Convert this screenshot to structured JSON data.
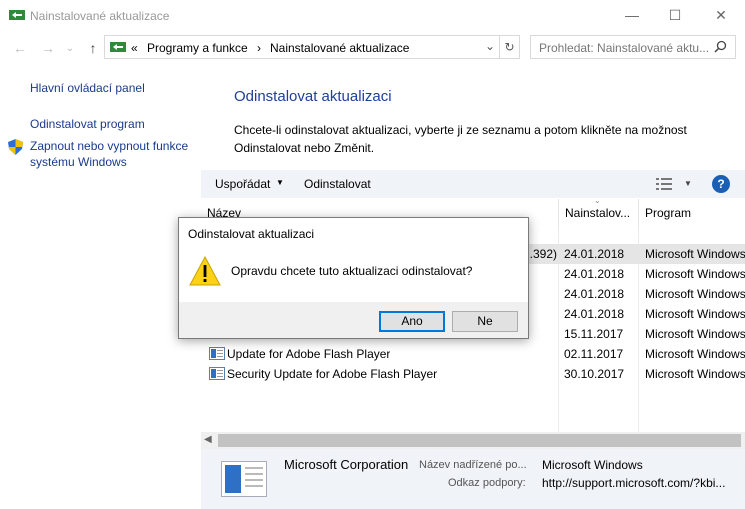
{
  "window": {
    "title": "Nainstalované aktualizace",
    "minimize": "—",
    "maximize": "☐",
    "close": "✕"
  },
  "address": {
    "crumb1": "Programy a funkce",
    "crumb2": "Nainstalované aktualizace",
    "sep": "›",
    "prefix": "«"
  },
  "search": {
    "placeholder": "Prohledat: Nainstalované aktu..."
  },
  "left_panel": {
    "home": "Hlavní ovládací panel",
    "uninstall_program": "Odinstalovat program",
    "features_line1": "Zapnout nebo vypnout funkce",
    "features_line2": "systému Windows"
  },
  "main": {
    "title": "Odinstalovat aktualizaci",
    "description_line1": "Chcete-li odinstalovat aktualizaci, vyberte ji ze seznamu a potom klikněte na možnost",
    "description_line2": "Odinstalovat nebo Změnit."
  },
  "toolbar": {
    "organize": "Uspořádat",
    "uninstall": "Odinstalovat",
    "help": "?"
  },
  "columns": {
    "name": "Název",
    "installed": "Nainstalov...",
    "program": "Program"
  },
  "rows": [
    {
      "name": "...392)",
      "date": "24.01.2018",
      "program": "Microsoft Windows"
    },
    {
      "name": "",
      "date": "24.01.2018",
      "program": "Microsoft Windows"
    },
    {
      "name": "",
      "date": "24.01.2018",
      "program": "Microsoft Windows"
    },
    {
      "name": "",
      "date": "24.01.2018",
      "program": "Microsoft Windows"
    },
    {
      "name": "",
      "date": "15.11.2017",
      "program": "Microsoft Windows"
    },
    {
      "name": "Update for Adobe Flash Player",
      "date": "02.11.2017",
      "program": "Microsoft Windows"
    },
    {
      "name": "Security Update for Adobe Flash Player",
      "date": "30.10.2017",
      "program": "Microsoft Windows"
    }
  ],
  "details": {
    "publisher": "Microsoft Corporation",
    "parent_label": "Název nadřízené po...",
    "parent_value": "Microsoft Windows",
    "support_label": "Odkaz podpory:",
    "support_value": "http://support.microsoft.com/?kbi..."
  },
  "dialog": {
    "title": "Odinstalovat aktualizaci",
    "message": "Opravdu chcete tuto aktualizaci odinstalovat?",
    "yes": "Ano",
    "no": "Ne"
  },
  "colors": {
    "link": "#1a3b8a",
    "title": "#1e3f9a",
    "accent": "#0078d7",
    "panel": "#f0f3f8"
  }
}
